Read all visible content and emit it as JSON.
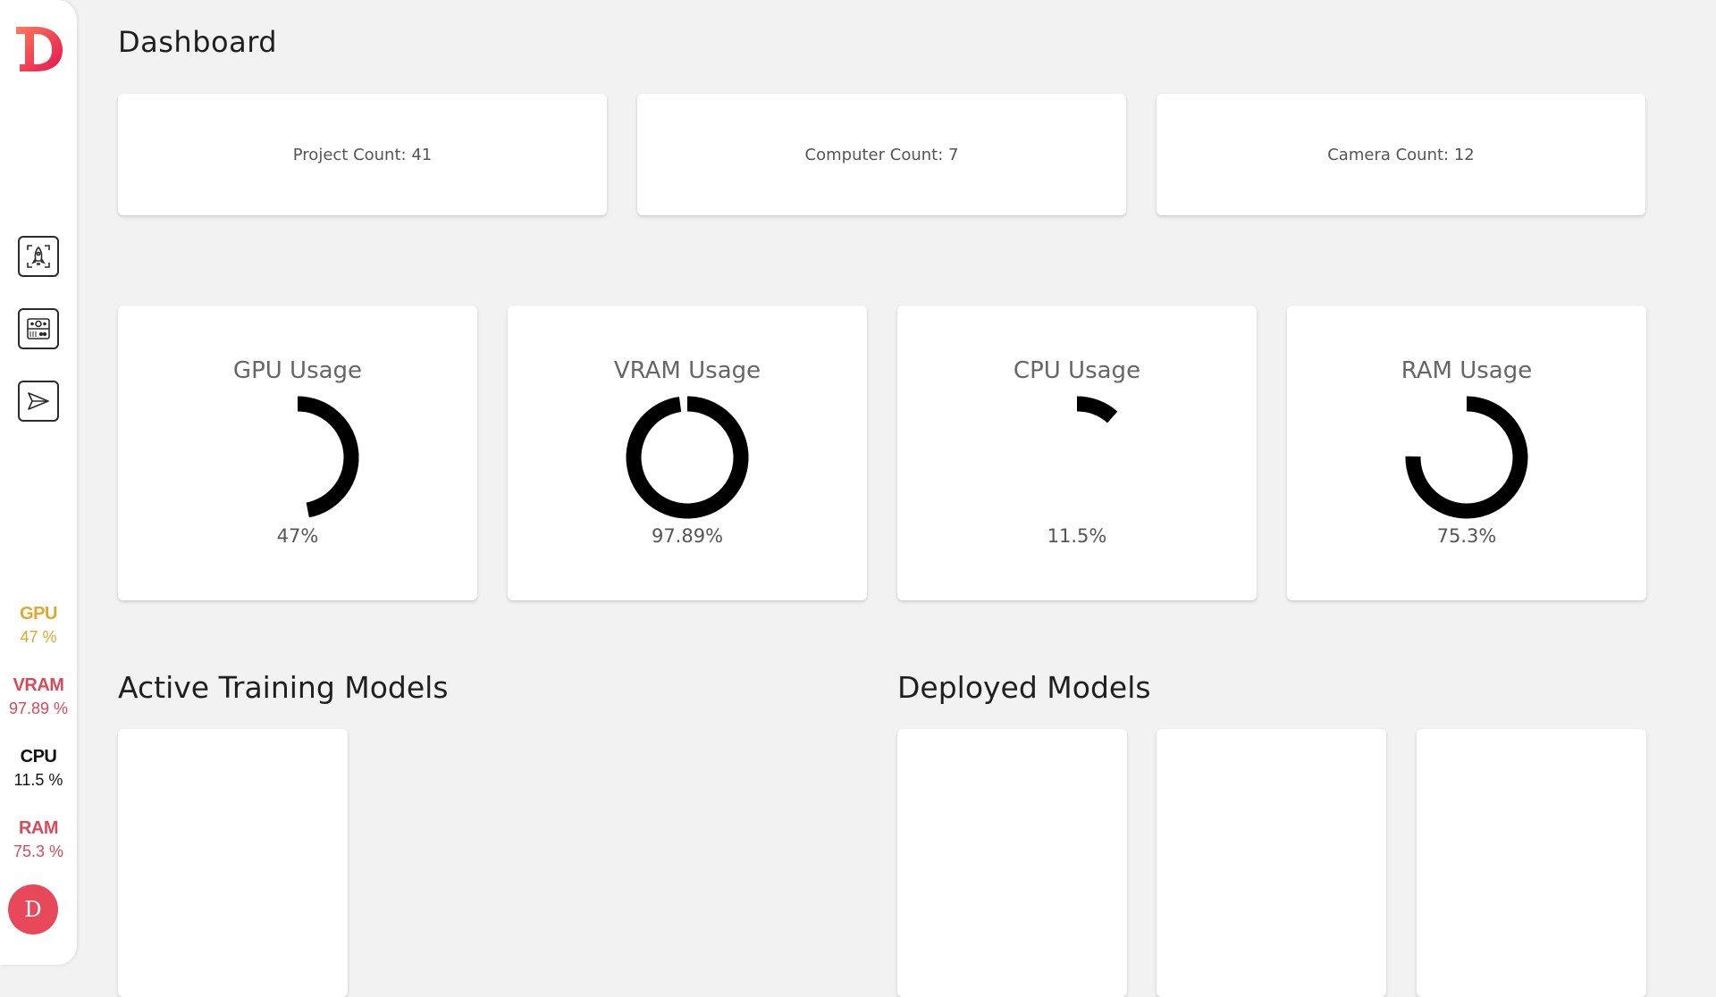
{
  "colors": {
    "gpu": "#e0a82e",
    "vram": "#d94a5a",
    "cpu": "#111111",
    "ram": "#d94a5a",
    "avatar": "#e8495a",
    "logo_gradient": [
      "#ff6a5c",
      "#e5194f"
    ]
  },
  "sidebar": {
    "logo_icon": "brand-d-logo",
    "nav": [
      {
        "icon": "rocket-icon"
      },
      {
        "icon": "device-camera-icon"
      },
      {
        "icon": "send-icon"
      }
    ],
    "stats": [
      {
        "label": "GPU",
        "value": "47 %"
      },
      {
        "label": "VRAM",
        "value": "97.89 %"
      },
      {
        "label": "CPU",
        "value": "11.5 %"
      },
      {
        "label": "RAM",
        "value": "75.3 %"
      }
    ],
    "avatar_letter": "D"
  },
  "page": {
    "title": "Dashboard"
  },
  "counts": [
    {
      "text": "Project Count: 41"
    },
    {
      "text": "Computer Count: 7"
    },
    {
      "text": "Camera Count: 12"
    }
  ],
  "gauges": [
    {
      "title": "GPU Usage",
      "value_text": "47%",
      "fraction": 0.47
    },
    {
      "title": "VRAM Usage",
      "value_text": "97.89%",
      "fraction": 0.9789
    },
    {
      "title": "CPU Usage",
      "value_text": "11.5%",
      "fraction": 0.115
    },
    {
      "title": "RAM Usage",
      "value_text": "75.3%",
      "fraction": 0.753
    }
  ],
  "sections": {
    "active_training": "Active Training Models",
    "deployed": "Deployed Models"
  }
}
